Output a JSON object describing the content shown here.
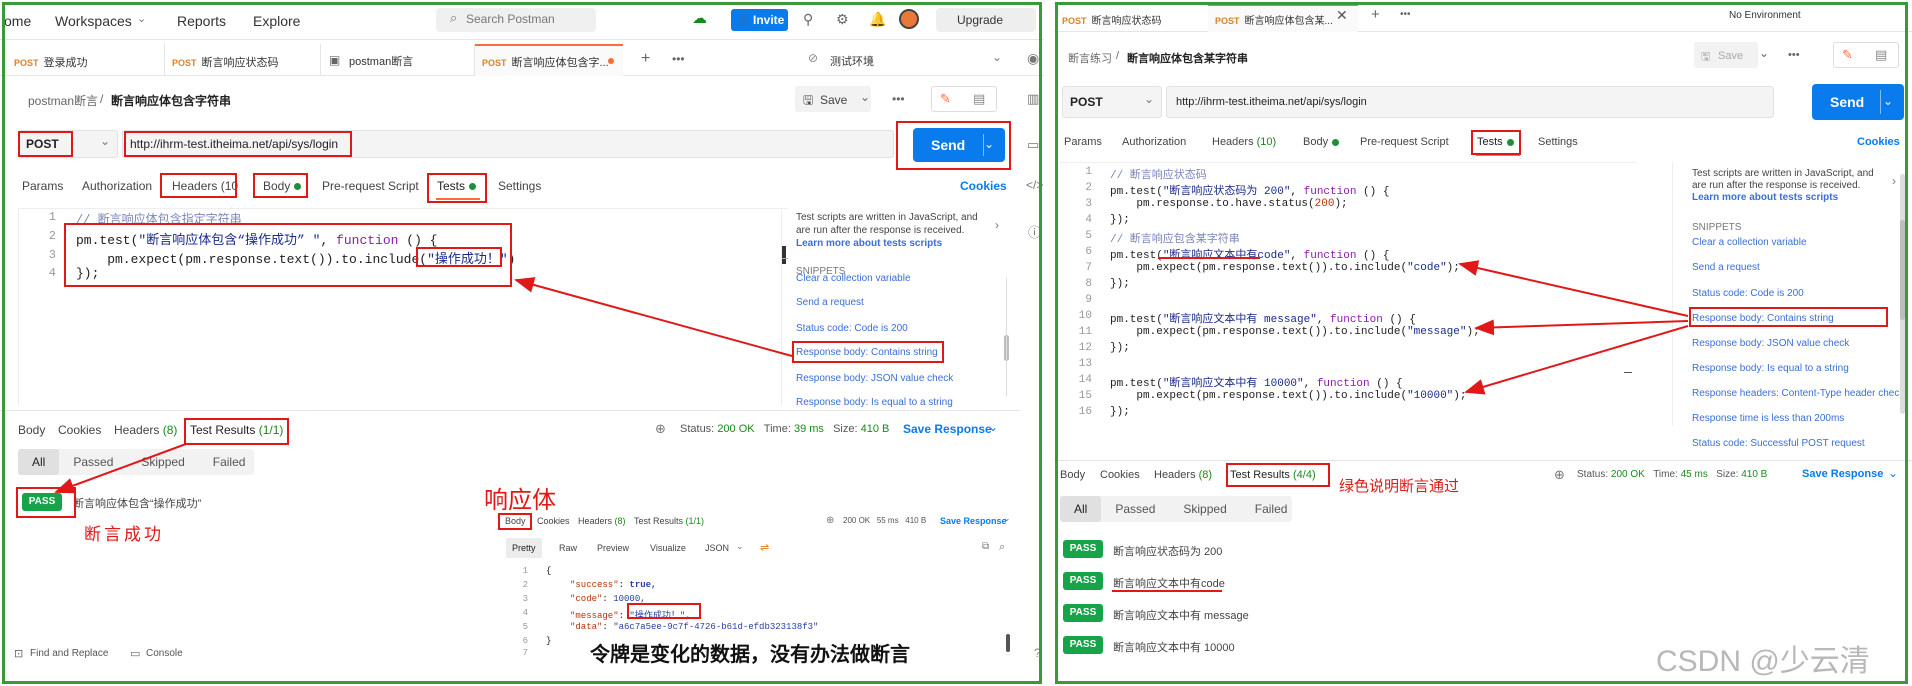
{
  "left": {
    "topbar": {
      "home": "ome",
      "workspaces": "Workspaces",
      "reports": "Reports",
      "explore": "Explore",
      "search_placeholder": "Search Postman",
      "invite": "Invite",
      "upgrade": "Upgrade"
    },
    "tabs": [
      {
        "method": "POST",
        "label": "登录成功"
      },
      {
        "method": "POST",
        "label": "断言响应状态码"
      },
      {
        "method": "",
        "label": "postman断言"
      },
      {
        "method": "POST",
        "label": "断言响应体包含字..."
      }
    ],
    "env": "测试环境",
    "breadcrumb": {
      "parent": "postman断言",
      "sep": "/",
      "current": "断言响应体包含字符串"
    },
    "save": "Save",
    "method": "POST",
    "url": "http://ihrm-test.itheima.net/api/sys/login",
    "send": "Send",
    "req_tabs": {
      "params": "Params",
      "auth": "Authorization",
      "headers": "Headers (10",
      "body": "Body",
      "pre": "Pre-request Script",
      "tests": "Tests",
      "settings": "Settings",
      "cookies": "Cookies"
    },
    "code_lines": [
      "1",
      "2",
      "3",
      "4"
    ],
    "code": {
      "l1": "// 断言响应体包含指定字符串",
      "l2a": "pm.test(",
      "l2b": "\"断言响应体包含“操作成功” \"",
      "l2c": ", ",
      "l2d": "function",
      "l2e": " () {",
      "l3a": "    pm.expect(pm.response.text()).to.include(",
      "l3b": "\"操作成功！\"",
      "l3c": ")",
      "l4": "});"
    },
    "snippets": {
      "intro1": "Test scripts are written in JavaScript, and",
      "intro2": "are run after the response is received.",
      "learn": "Learn more about tests scripts",
      "header": "SNIPPETS",
      "items": [
        "Clear a collection variable",
        "Send a request",
        "Status code: Code is 200",
        "Response body: Contains string",
        "Response body: JSON value check",
        "Response body: Is equal to a string"
      ]
    },
    "resp_tabs": {
      "body": "Body",
      "cookies": "Cookies",
      "headers": "Headers",
      "headers_count": "(8)",
      "tests": "Test Results",
      "tests_count": "(1/1)"
    },
    "status": {
      "label": "Status:",
      "code": "200 OK",
      "time_label": "Time:",
      "time": "39 ms",
      "size_label": "Size:",
      "size": "410 B",
      "save_resp": "Save Response"
    },
    "filters": [
      "All",
      "Passed",
      "Skipped",
      "Failed"
    ],
    "pass_label": "PASS",
    "result": "断言响应体包含“操作成功”",
    "annot_success": "断言成功",
    "annot_body": "响应体",
    "annot_token": "令牌是变化的数据，没有办法做断言",
    "mini": {
      "body": "Body",
      "cookies": "Cookies",
      "headers": "Headers",
      "headers_count": "(8)",
      "tests": "Test Results",
      "tests_count": "(1/1)",
      "status": "200 OK",
      "time": "55 ms",
      "size": "410 B",
      "save": "Save Response",
      "pretty": "Pretty",
      "raw": "Raw",
      "preview": "Preview",
      "visualize": "Visualize",
      "format": "JSON",
      "lines": [
        "1",
        "2",
        "3",
        "4",
        "5",
        "6",
        "7"
      ],
      "j1": "{",
      "j2k": "\"success\"",
      "j2v": "true,",
      "j3k": "\"code\"",
      "j3v": "10000,",
      "j4k": "\"message\"",
      "j4v": "\"操作成功！\",",
      "j5k": "\"data\"",
      "j5v": "\"a6c7a5ee-9c7f-4726-b61d-efdb323138f3\"",
      "j6": "}"
    },
    "footer": {
      "find": "Find and Replace",
      "console": "Console"
    }
  },
  "right": {
    "tabs": [
      {
        "method": "POST",
        "label": "断言响应状态码"
      },
      {
        "method": "POST",
        "label": "断言响应体包含某..."
      }
    ],
    "env": "No Environment",
    "breadcrumb": {
      "parent": "断言练习",
      "sep": "/",
      "current": "断言响应体包含某字符串"
    },
    "save": "Save",
    "method": "POST",
    "url": "http://ihrm-test.itheima.net/api/sys/login",
    "send": "Send",
    "req_tabs": {
      "params": "Params",
      "auth": "Authorization",
      "headers": "Headers",
      "headers_count": "(10)",
      "body": "Body",
      "pre": "Pre-request Script",
      "tests": "Tests",
      "settings": "Settings",
      "cookies": "Cookies"
    },
    "code_lines": [
      "1",
      "2",
      "3",
      "4",
      "5",
      "6",
      "7",
      "8",
      "9",
      "10",
      "11",
      "12",
      "13",
      "14",
      "15",
      "16"
    ],
    "code": {
      "c1": "// 断言响应状态码",
      "c2a": "pm.test(",
      "c2b": "\"断言响应状态码为 200\"",
      "c2c": ", ",
      "c2d": "function",
      "c2e": " () {",
      "c3a": "    pm.response.to.have.status(",
      "c3b": "200",
      "c3c": ");",
      "c4": "});",
      "c5": "// 断言响应包含某字符串",
      "c6a": "pm.test(",
      "c6b": "\"断言响应文本中有code\"",
      "c6c": ", ",
      "c6d": "function",
      "c6e": " () {",
      "c7a": "    pm.expect(pm.response.text()).to.include(",
      "c7b": "\"code\"",
      "c7c": ");",
      "c8": "});",
      "c10a": "pm.test(",
      "c10b": "\"断言响应文本中有 message\"",
      "c10c": ", ",
      "c10d": "function",
      "c10e": " () {",
      "c11a": "    pm.expect(pm.response.text()).to.include(",
      "c11b": "\"message\"",
      "c11c": ");",
      "c12": "});",
      "c14a": "pm.test(",
      "c14b": "\"断言响应文本中有 10000\"",
      "c14c": ", ",
      "c14d": "function",
      "c14e": " () {",
      "c15a": "    pm.expect(pm.response.text()).to.include(",
      "c15b": "\"10000\"",
      "c15c": ");",
      "c16": "});"
    },
    "snippets": {
      "intro1": "Test scripts are written in JavaScript, and",
      "intro2": "are run after the response is received.",
      "learn": "Learn more about tests scripts",
      "header": "SNIPPETS",
      "items": [
        "Clear a collection variable",
        "Send a request",
        "Status code: Code is 200",
        "Response body: Contains string",
        "Response body: JSON value check",
        "Response body: Is equal to a string",
        "Response headers: Content-Type header check",
        "Response time is less than 200ms",
        "Status code: Successful POST request"
      ]
    },
    "resp_tabs": {
      "body": "Body",
      "cookies": "Cookies",
      "headers": "Headers",
      "headers_count": "(8)",
      "tests": "Test Results",
      "tests_count": "(4/4)"
    },
    "annot_green": "绿色说明断言通过",
    "status": {
      "label": "Status:",
      "code": "200 OK",
      "time_label": "Time:",
      "time": "45 ms",
      "size_label": "Size:",
      "size": "410 B",
      "save_resp": "Save Response"
    },
    "filters": [
      "All",
      "Passed",
      "Skipped",
      "Failed"
    ],
    "pass_label": "PASS",
    "results": [
      "断言响应状态码为 200",
      "断言响应文本中有code",
      "断言响应文本中有 message",
      "断言响应文本中有 10000"
    ],
    "watermark": "CSDN @少云清"
  },
  "colors": {
    "send": "#097bed",
    "pass": "#16a34a",
    "annot": "#e01818",
    "frame": "#3a9a3a",
    "tab_accent": "#ff6c37"
  }
}
